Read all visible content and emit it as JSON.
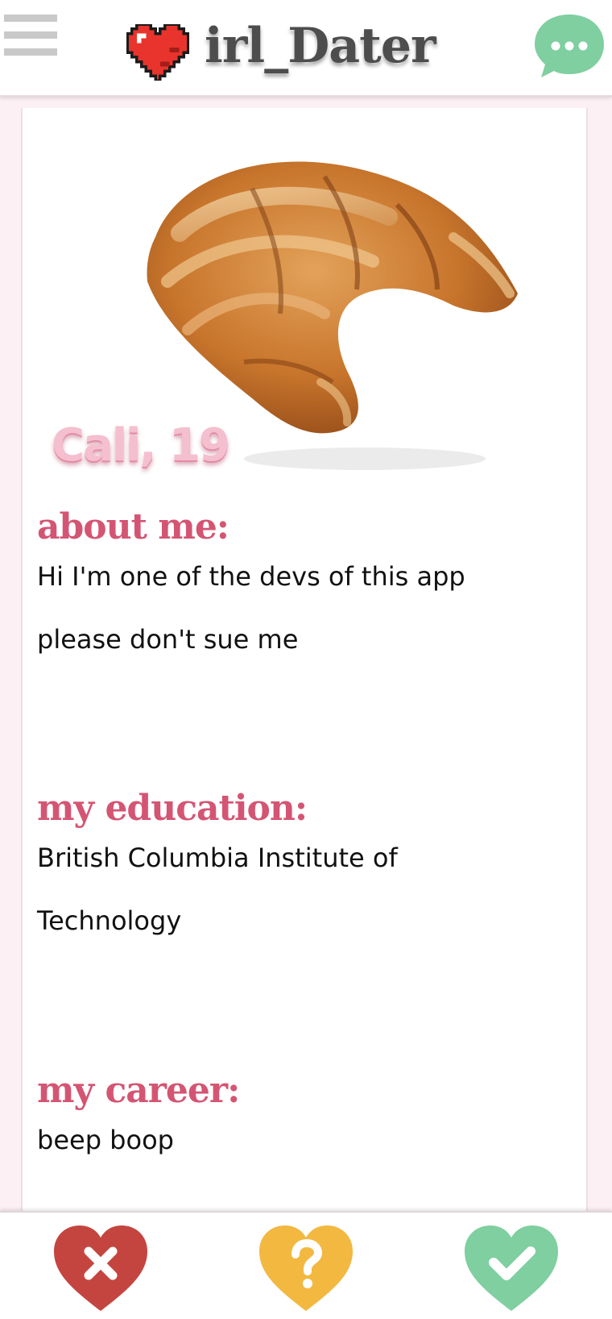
{
  "header": {
    "title": "irl_Dater",
    "menu_icon": "hamburger-menu-icon",
    "logo_icon": "pixel-heart-icon",
    "chat_icon": "chat-bubble-icon"
  },
  "profile": {
    "photo_icon": "croissant-photo",
    "name_age": "Cali, 19",
    "sections": [
      {
        "title": "about me:",
        "text": "Hi I'm one of the devs of this app please don't sue me"
      },
      {
        "title": "my education:",
        "text": "British Columbia Institute of Technology"
      },
      {
        "title": "my career:",
        "text": "beep boop"
      }
    ]
  },
  "actions": {
    "reject": {
      "icon": "x-heart-icon",
      "color": "#c4453f"
    },
    "maybe": {
      "icon": "question-heart-icon",
      "color": "#f2b840"
    },
    "accept": {
      "icon": "check-heart-icon",
      "color": "#7fcfa0"
    }
  },
  "colors": {
    "accent": "#d45573",
    "name_pink": "#f4bfcf",
    "background": "#fdf0f4",
    "chat_green": "#7fcfa0"
  }
}
